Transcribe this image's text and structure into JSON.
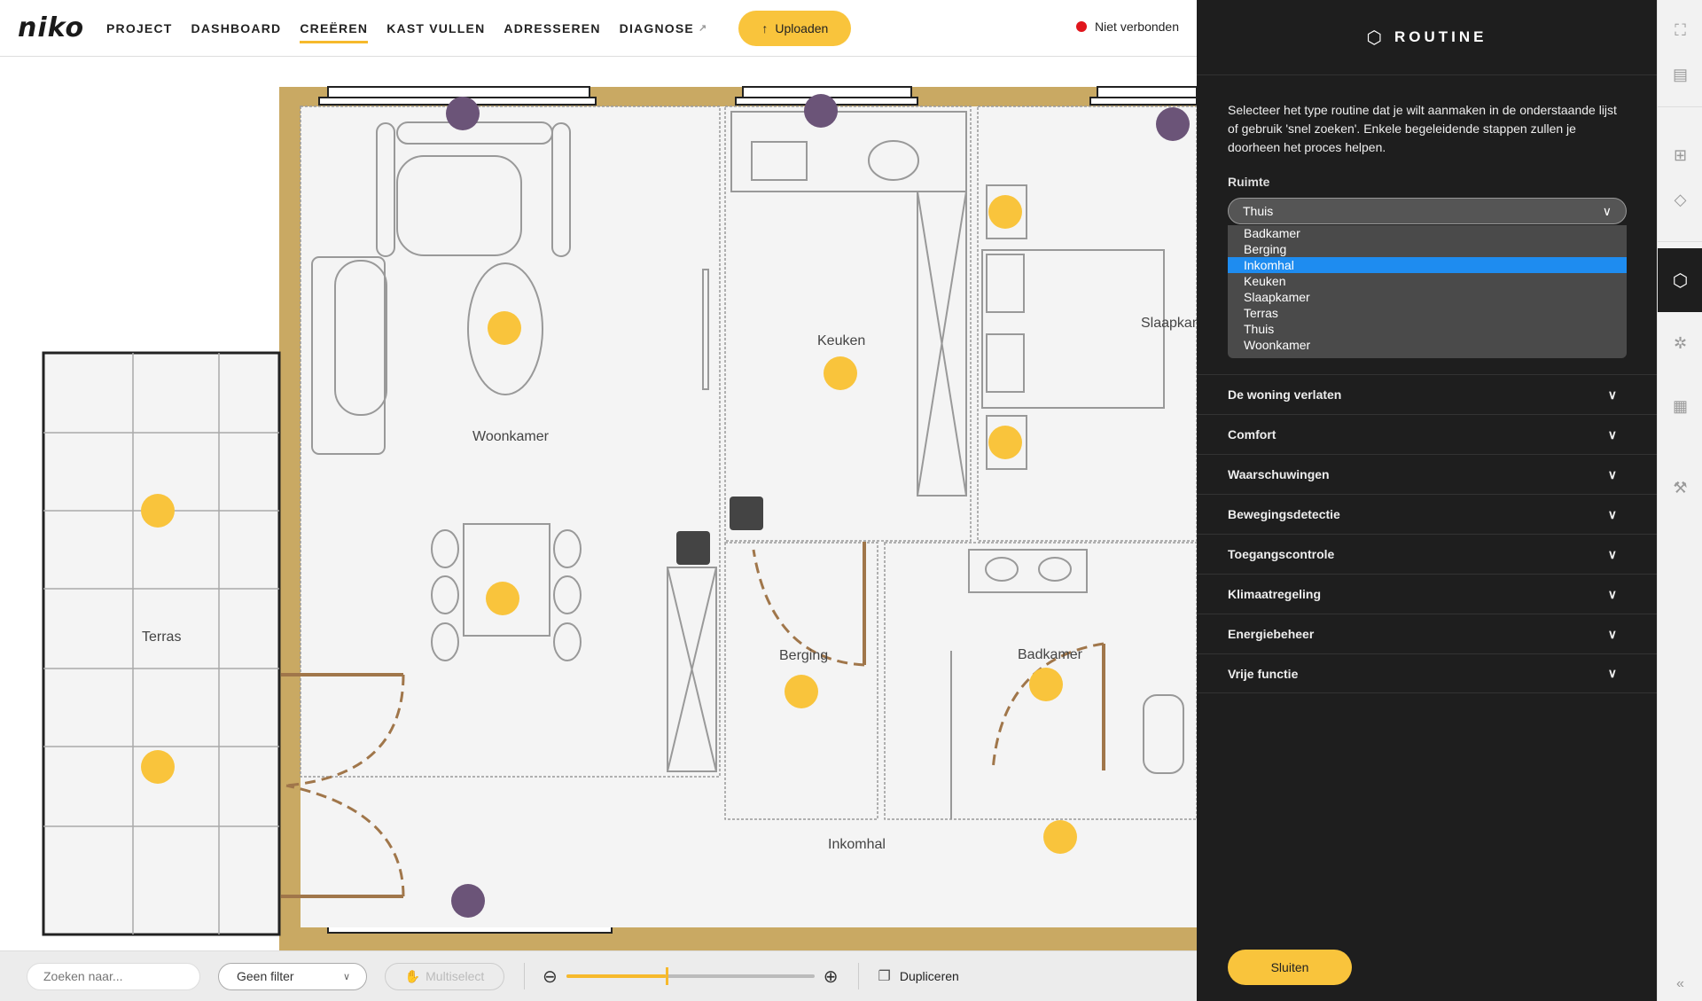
{
  "brand": {
    "logo": "niko",
    "accent": "#f9c43c"
  },
  "nav": [
    {
      "label": "PROJECT"
    },
    {
      "label": "DASHBOARD"
    },
    {
      "label": "CREËREN",
      "active": true
    },
    {
      "label": "KAST VULLEN"
    },
    {
      "label": "ADRESSEREN"
    },
    {
      "label": "DIAGNOSE",
      "external": true
    }
  ],
  "upload_label": "Uploaden",
  "connection": {
    "status": "Niet verbonden",
    "color": "#e0151c"
  },
  "rooms": [
    "Woonkamer",
    "Keuken",
    "Slaapkamer",
    "Terras",
    "Berging",
    "Badkamer",
    "Inkomhal"
  ],
  "toolbar": {
    "search_placeholder": "Zoeken naar...",
    "filter": "Geen filter",
    "multiselect": "Multiselect",
    "zoom_percent": 40,
    "duplicate": "Dupliceren"
  },
  "panel": {
    "title": "ROUTINE",
    "intro": "Selecteer het type routine dat je wilt aanmaken in de onderstaande lijst of gebruik 'snel zoeken'. Enkele begeleidende stappen zullen je doorheen het proces helpen.",
    "ruimte_label": "Ruimte",
    "selected": "Thuis",
    "options": [
      "Badkamer",
      "Berging",
      "Inkomhal",
      "Keuken",
      "Slaapkamer",
      "Terras",
      "Thuis",
      "Woonkamer"
    ],
    "highlighted": "Inkomhal",
    "sections": [
      "De woning verlaten",
      "Comfort",
      "Waarschuwingen",
      "Bewegingsdetectie",
      "Toegangscontrole",
      "Klimaatregeling",
      "Energiebeheer",
      "Vrije functie"
    ],
    "close_label": "Sluiten"
  }
}
